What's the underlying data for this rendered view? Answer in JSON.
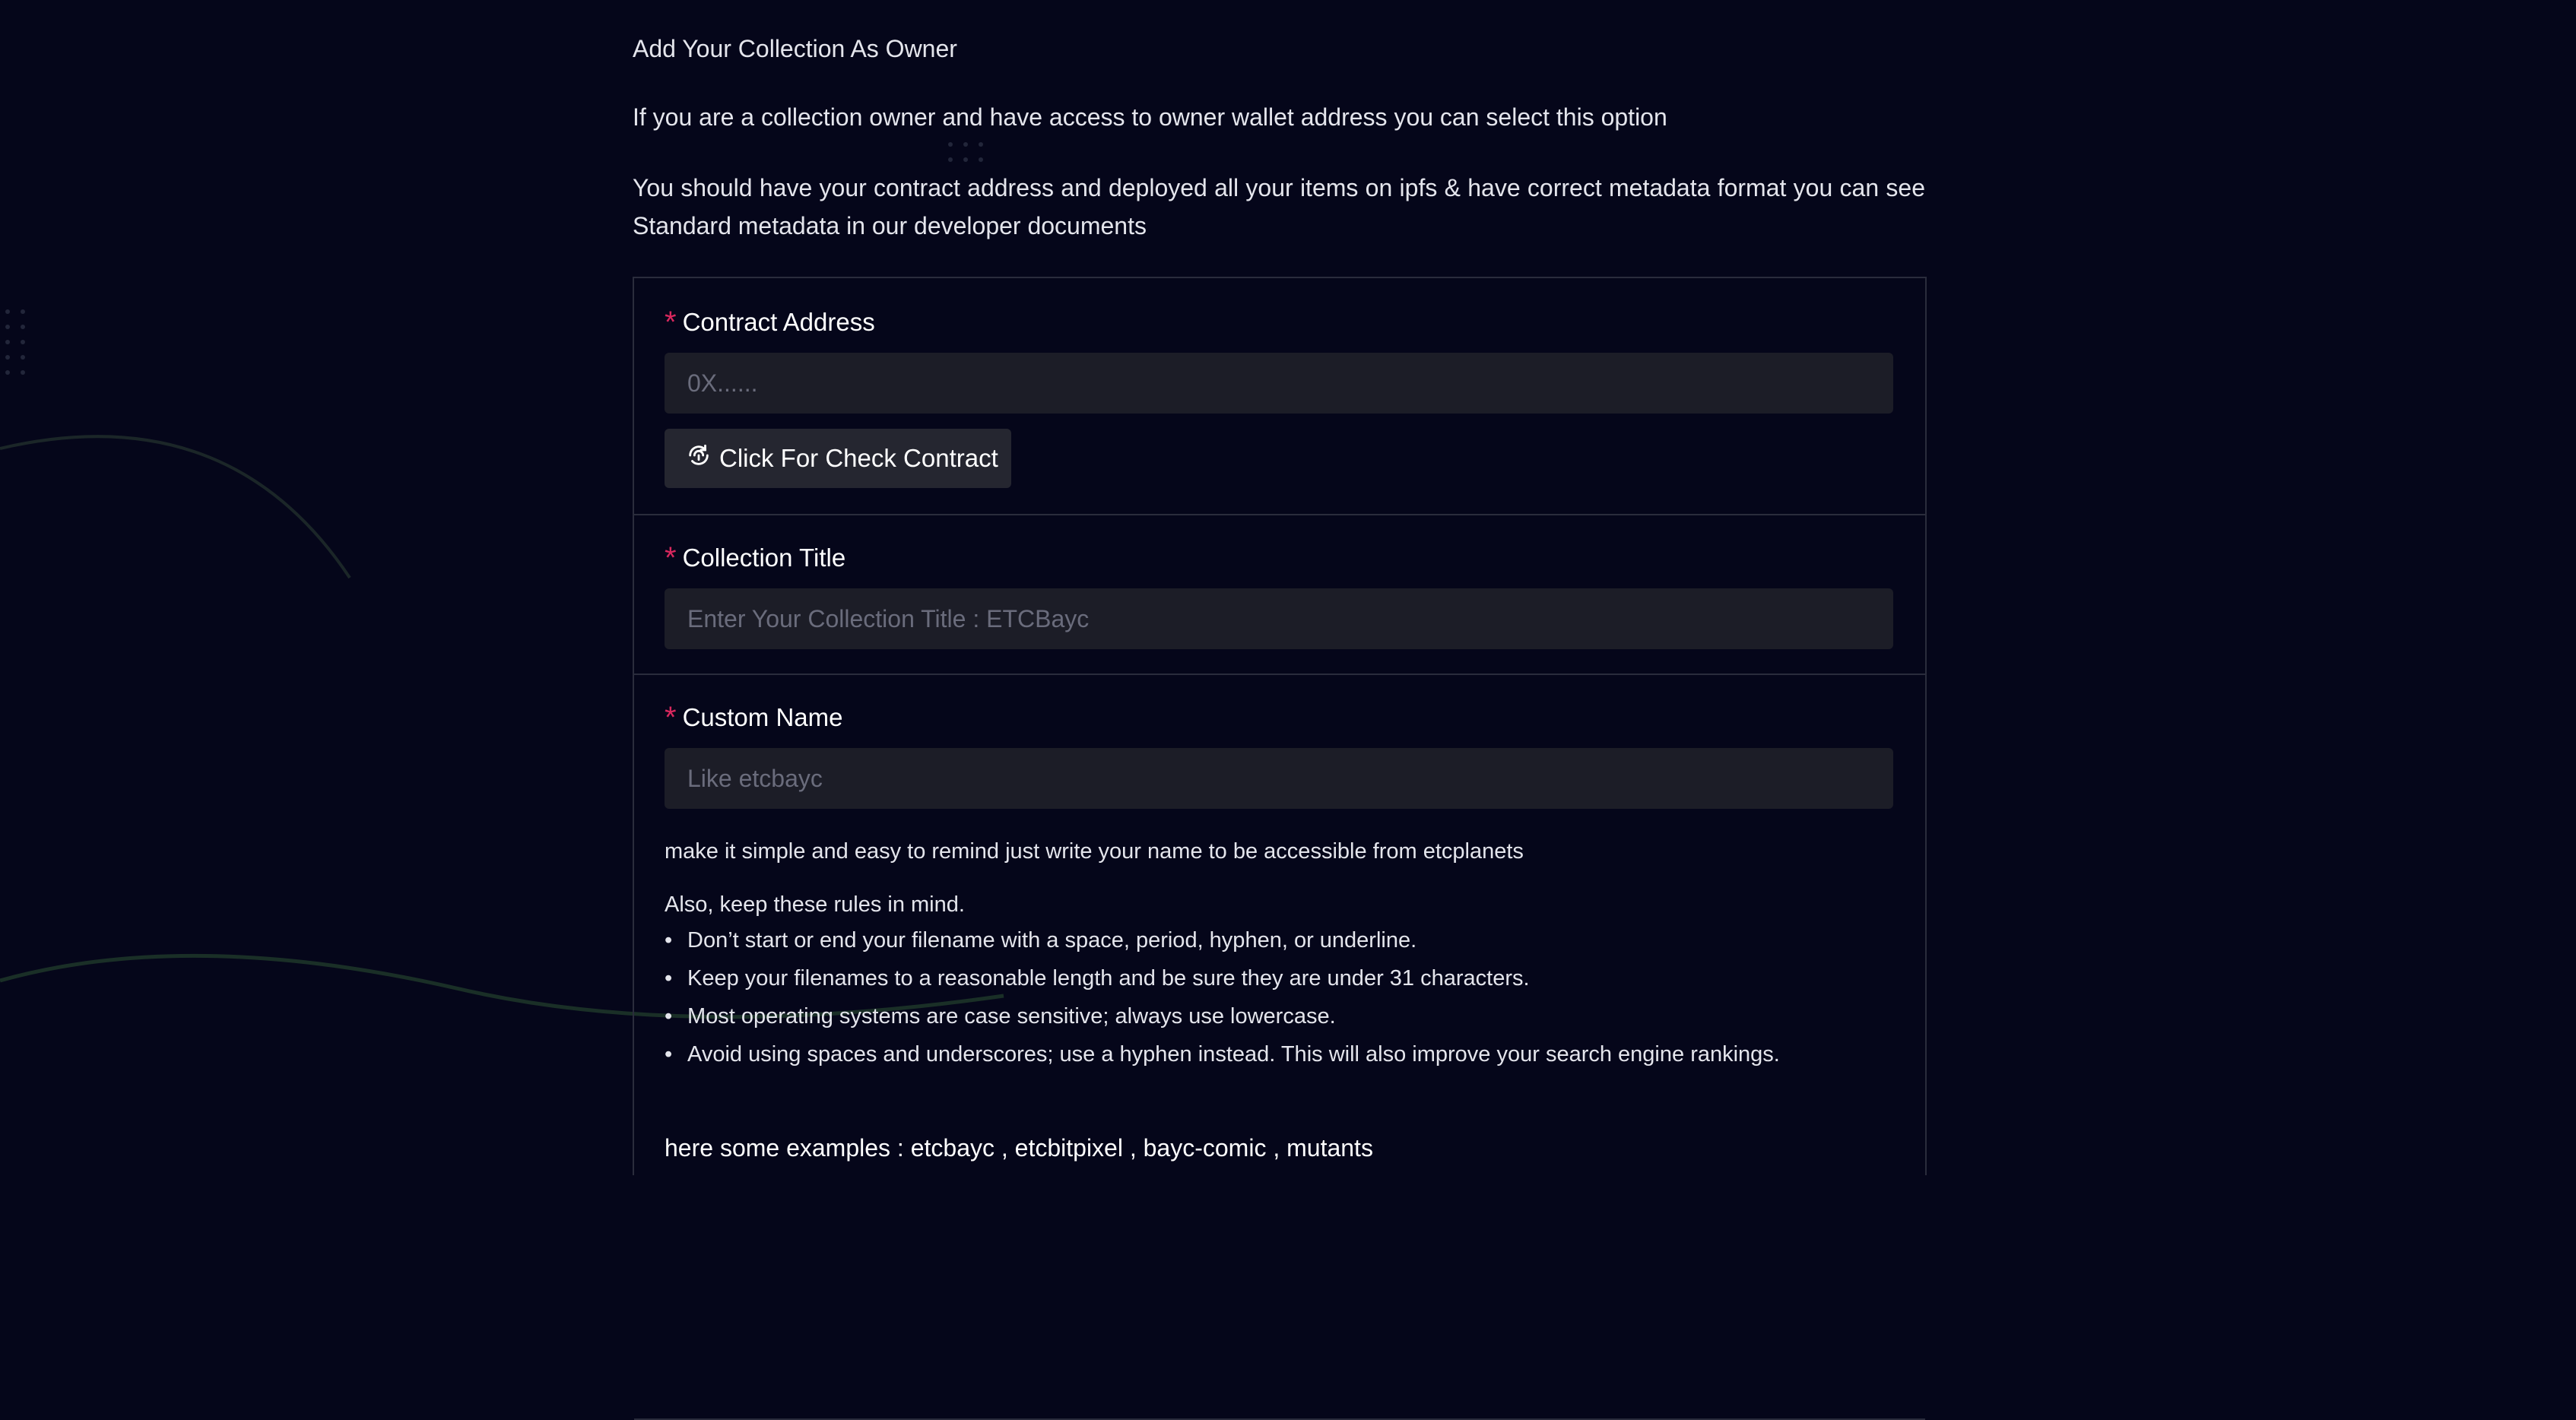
{
  "intro": {
    "heading": "Add Your Collection As Owner",
    "paragraph1": "If you are a collection owner and have access to owner wallet address you can select this option",
    "paragraph2": "You should have your contract address and deployed all your items on ipfs & have correct metadata format you can see Standard metadata in our developer documents"
  },
  "form": {
    "contract_address": {
      "label": "Contract Address",
      "required_mark": "*",
      "placeholder": "0X......",
      "value": "",
      "check_button_label": "Click For Check Contract"
    },
    "collection_title": {
      "label": "Collection Title",
      "required_mark": "*",
      "placeholder": "Enter Your Collection Title : ETCBayc",
      "value": ""
    },
    "custom_name": {
      "label": "Custom Name",
      "required_mark": "*",
      "placeholder": "Like etcbayc",
      "value": "",
      "hint": "make it simple and easy to remind just write your name to be accessible from etcplanets",
      "rules_title": "Also, keep these rules in mind.",
      "rules": [
        "Don’t start or end your filename with a space, period, hyphen, or underline.",
        "Keep your filenames to a reasonable length and be sure they are under 31 characters.",
        "Most operating systems are case sensitive; always use lowercase.",
        "Avoid using spaces and underscores; use a hyphen instead. This will also improve your search engine rankings."
      ],
      "examples": "here some examples : etcbayc , etcbitpixel , bayc-comic , mutants"
    }
  },
  "colors": {
    "background": "#05061a",
    "input_bg": "#1c1d27",
    "required": "#d9285e",
    "border": "#2a2c3c"
  },
  "icons": {
    "check_button": "refresh-fingerprint-icon"
  }
}
